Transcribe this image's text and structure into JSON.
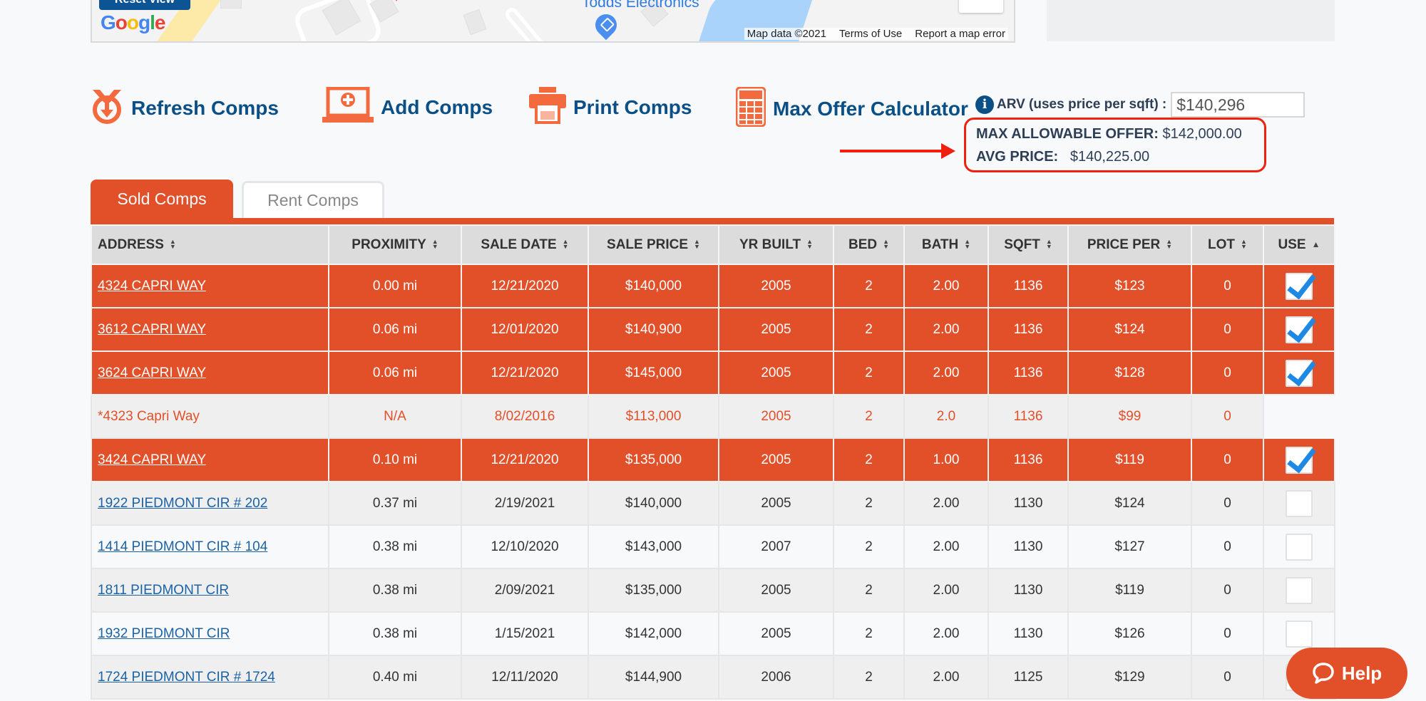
{
  "map": {
    "reset_view_label": "Reset View",
    "google_logo": [
      "G",
      "o",
      "o",
      "g",
      "l",
      "e"
    ],
    "poi_label": "Todds Electronics",
    "attribution": [
      "Map data ©2021",
      "Terms of Use",
      "Report a map error"
    ]
  },
  "toolbar": {
    "refresh_label": "Refresh Comps",
    "add_label": "Add Comps",
    "print_label": "Print Comps",
    "calculator_label": "Max Offer Calculator"
  },
  "arv": {
    "info_glyph": "i",
    "label": "ARV (uses price per sqft) :",
    "value": "$140,296"
  },
  "offer": {
    "max_label": "MAX ALLOWABLE OFFER:",
    "max_value": "$142,000.00",
    "avg_label": "AVG PRICE:",
    "avg_value": "$140,225.00"
  },
  "tabs": [
    {
      "label": "Sold Comps",
      "active": true
    },
    {
      "label": "Rent Comps",
      "active": false
    }
  ],
  "table": {
    "headers": [
      "ADDRESS",
      "PROXIMITY",
      "SALE DATE",
      "SALE PRICE",
      "YR BUILT",
      "BED",
      "BATH",
      "SQFT",
      "PRICE PER",
      "LOT",
      "USE"
    ],
    "sort_glyph": "⬍",
    "use_sort_glyph": "▲",
    "rows": [
      {
        "address": "4324 CAPRI WAY",
        "proximity": "0.00 mi",
        "sale_date": "12/21/2020",
        "sale_price": "$140,000",
        "yr_built": "2005",
        "bed": "2",
        "bath": "2.00",
        "sqft": "1136",
        "price_per": "$123",
        "lot": "0",
        "use": true,
        "state": "selected"
      },
      {
        "address": "3612 CAPRI WAY",
        "proximity": "0.06 mi",
        "sale_date": "12/01/2020",
        "sale_price": "$140,900",
        "yr_built": "2005",
        "bed": "2",
        "bath": "2.00",
        "sqft": "1136",
        "price_per": "$124",
        "lot": "0",
        "use": true,
        "state": "selected"
      },
      {
        "address": "3624 CAPRI WAY",
        "proximity": "0.06 mi",
        "sale_date": "12/21/2020",
        "sale_price": "$145,000",
        "yr_built": "2005",
        "bed": "2",
        "bath": "2.00",
        "sqft": "1136",
        "price_per": "$128",
        "lot": "0",
        "use": true,
        "state": "selected"
      },
      {
        "address": "*4323 Capri Way",
        "proximity": "N/A",
        "sale_date": "8/02/2016",
        "sale_price": "$113,000",
        "yr_built": "2005",
        "bed": "2",
        "bath": "2.0",
        "sqft": "1136",
        "price_per": "$99",
        "lot": "0",
        "use": null,
        "state": "subject"
      },
      {
        "address": "3424 CAPRI WAY",
        "proximity": "0.10 mi",
        "sale_date": "12/21/2020",
        "sale_price": "$135,000",
        "yr_built": "2005",
        "bed": "2",
        "bath": "1.00",
        "sqft": "1136",
        "price_per": "$119",
        "lot": "0",
        "use": true,
        "state": "selected"
      },
      {
        "address": "1922 PIEDMONT CIR # 202",
        "proximity": "0.37 mi",
        "sale_date": "2/19/2021",
        "sale_price": "$140,000",
        "yr_built": "2005",
        "bed": "2",
        "bath": "2.00",
        "sqft": "1130",
        "price_per": "$124",
        "lot": "0",
        "use": false,
        "state": "odd"
      },
      {
        "address": "1414 PIEDMONT CIR # 104",
        "proximity": "0.38 mi",
        "sale_date": "12/10/2020",
        "sale_price": "$143,000",
        "yr_built": "2007",
        "bed": "2",
        "bath": "2.00",
        "sqft": "1130",
        "price_per": "$127",
        "lot": "0",
        "use": false,
        "state": "even"
      },
      {
        "address": "1811 PIEDMONT CIR",
        "proximity": "0.38 mi",
        "sale_date": "2/09/2021",
        "sale_price": "$135,000",
        "yr_built": "2005",
        "bed": "2",
        "bath": "2.00",
        "sqft": "1130",
        "price_per": "$119",
        "lot": "0",
        "use": false,
        "state": "odd"
      },
      {
        "address": "1932 PIEDMONT CIR",
        "proximity": "0.38 mi",
        "sale_date": "1/15/2021",
        "sale_price": "$142,000",
        "yr_built": "2005",
        "bed": "2",
        "bath": "2.00",
        "sqft": "1130",
        "price_per": "$126",
        "lot": "0",
        "use": false,
        "state": "even"
      },
      {
        "address": "1724 PIEDMONT CIR # 1724",
        "proximity": "0.40 mi",
        "sale_date": "12/11/2020",
        "sale_price": "$144,900",
        "yr_built": "2006",
        "bed": "2",
        "bath": "2.00",
        "sqft": "1125",
        "price_per": "$129",
        "lot": "0",
        "use": false,
        "state": "odd"
      }
    ]
  },
  "help": {
    "label": "Help"
  },
  "colors": {
    "accent": "#e2502a",
    "brand_blue": "#0b4f87",
    "link_blue": "#1b62a5",
    "highlight_red": "#f0200f",
    "check_blue": "#1e88e5"
  }
}
